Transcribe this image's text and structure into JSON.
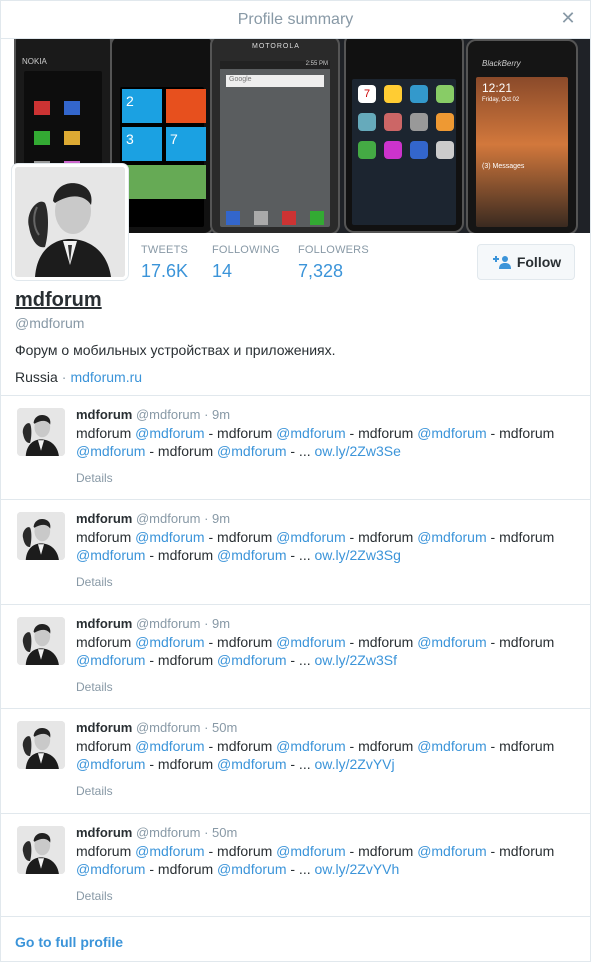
{
  "modal": {
    "title": "Profile summary",
    "close_icon": "close-icon"
  },
  "banner": {
    "phone_labels": [
      "NOKIA",
      "MOTOROLA",
      "BlackBerry"
    ],
    "wp_tiles": [
      "2",
      "3",
      "7"
    ],
    "moto_search": "Google",
    "bb_time": "12:21",
    "bb_date": "Friday, Oct 02",
    "bb_messages": "(3) Messages",
    "moto_time": "2:55 PM",
    "iphone_date": "7"
  },
  "stats": {
    "tweets_label": "TWEETS",
    "tweets_value": "17.6K",
    "following_label": "FOLLOWING",
    "following_value": "14",
    "followers_label": "FOLLOWERS",
    "followers_value": "7,328"
  },
  "follow_button": {
    "label": "Follow",
    "icon": "add-person-icon"
  },
  "profile": {
    "name": "mdforum",
    "handle": "@mdforum",
    "bio": "Форум о мобильных устройствах и приложениях.",
    "location": "Russia",
    "separator": "·",
    "website": "mdforum.ru"
  },
  "tweets": [
    {
      "name": "mdforum",
      "handle": "@mdforum",
      "time": "9m",
      "link": "ow.ly/2Zw3Se",
      "details": "Details"
    },
    {
      "name": "mdforum",
      "handle": "@mdforum",
      "time": "9m",
      "link": "ow.ly/2Zw3Sg",
      "details": "Details"
    },
    {
      "name": "mdforum",
      "handle": "@mdforum",
      "time": "9m",
      "link": "ow.ly/2Zw3Sf",
      "details": "Details"
    },
    {
      "name": "mdforum",
      "handle": "@mdforum",
      "time": "50m",
      "link": "ow.ly/2ZvYVj",
      "details": "Details"
    },
    {
      "name": "mdforum",
      "handle": "@mdforum",
      "time": "50m",
      "link": "ow.ly/2ZvYVh",
      "details": "Details"
    }
  ],
  "tweet_text": {
    "word": "mdforum",
    "mention": "@mdforum",
    "dash": " - ",
    "ellipsis": " - ... "
  },
  "footer": {
    "link": "Go to full profile"
  },
  "colors": {
    "accent": "#3b94d9",
    "muted": "#8899a6",
    "text": "#292f33",
    "border": "#e1e8ed"
  }
}
